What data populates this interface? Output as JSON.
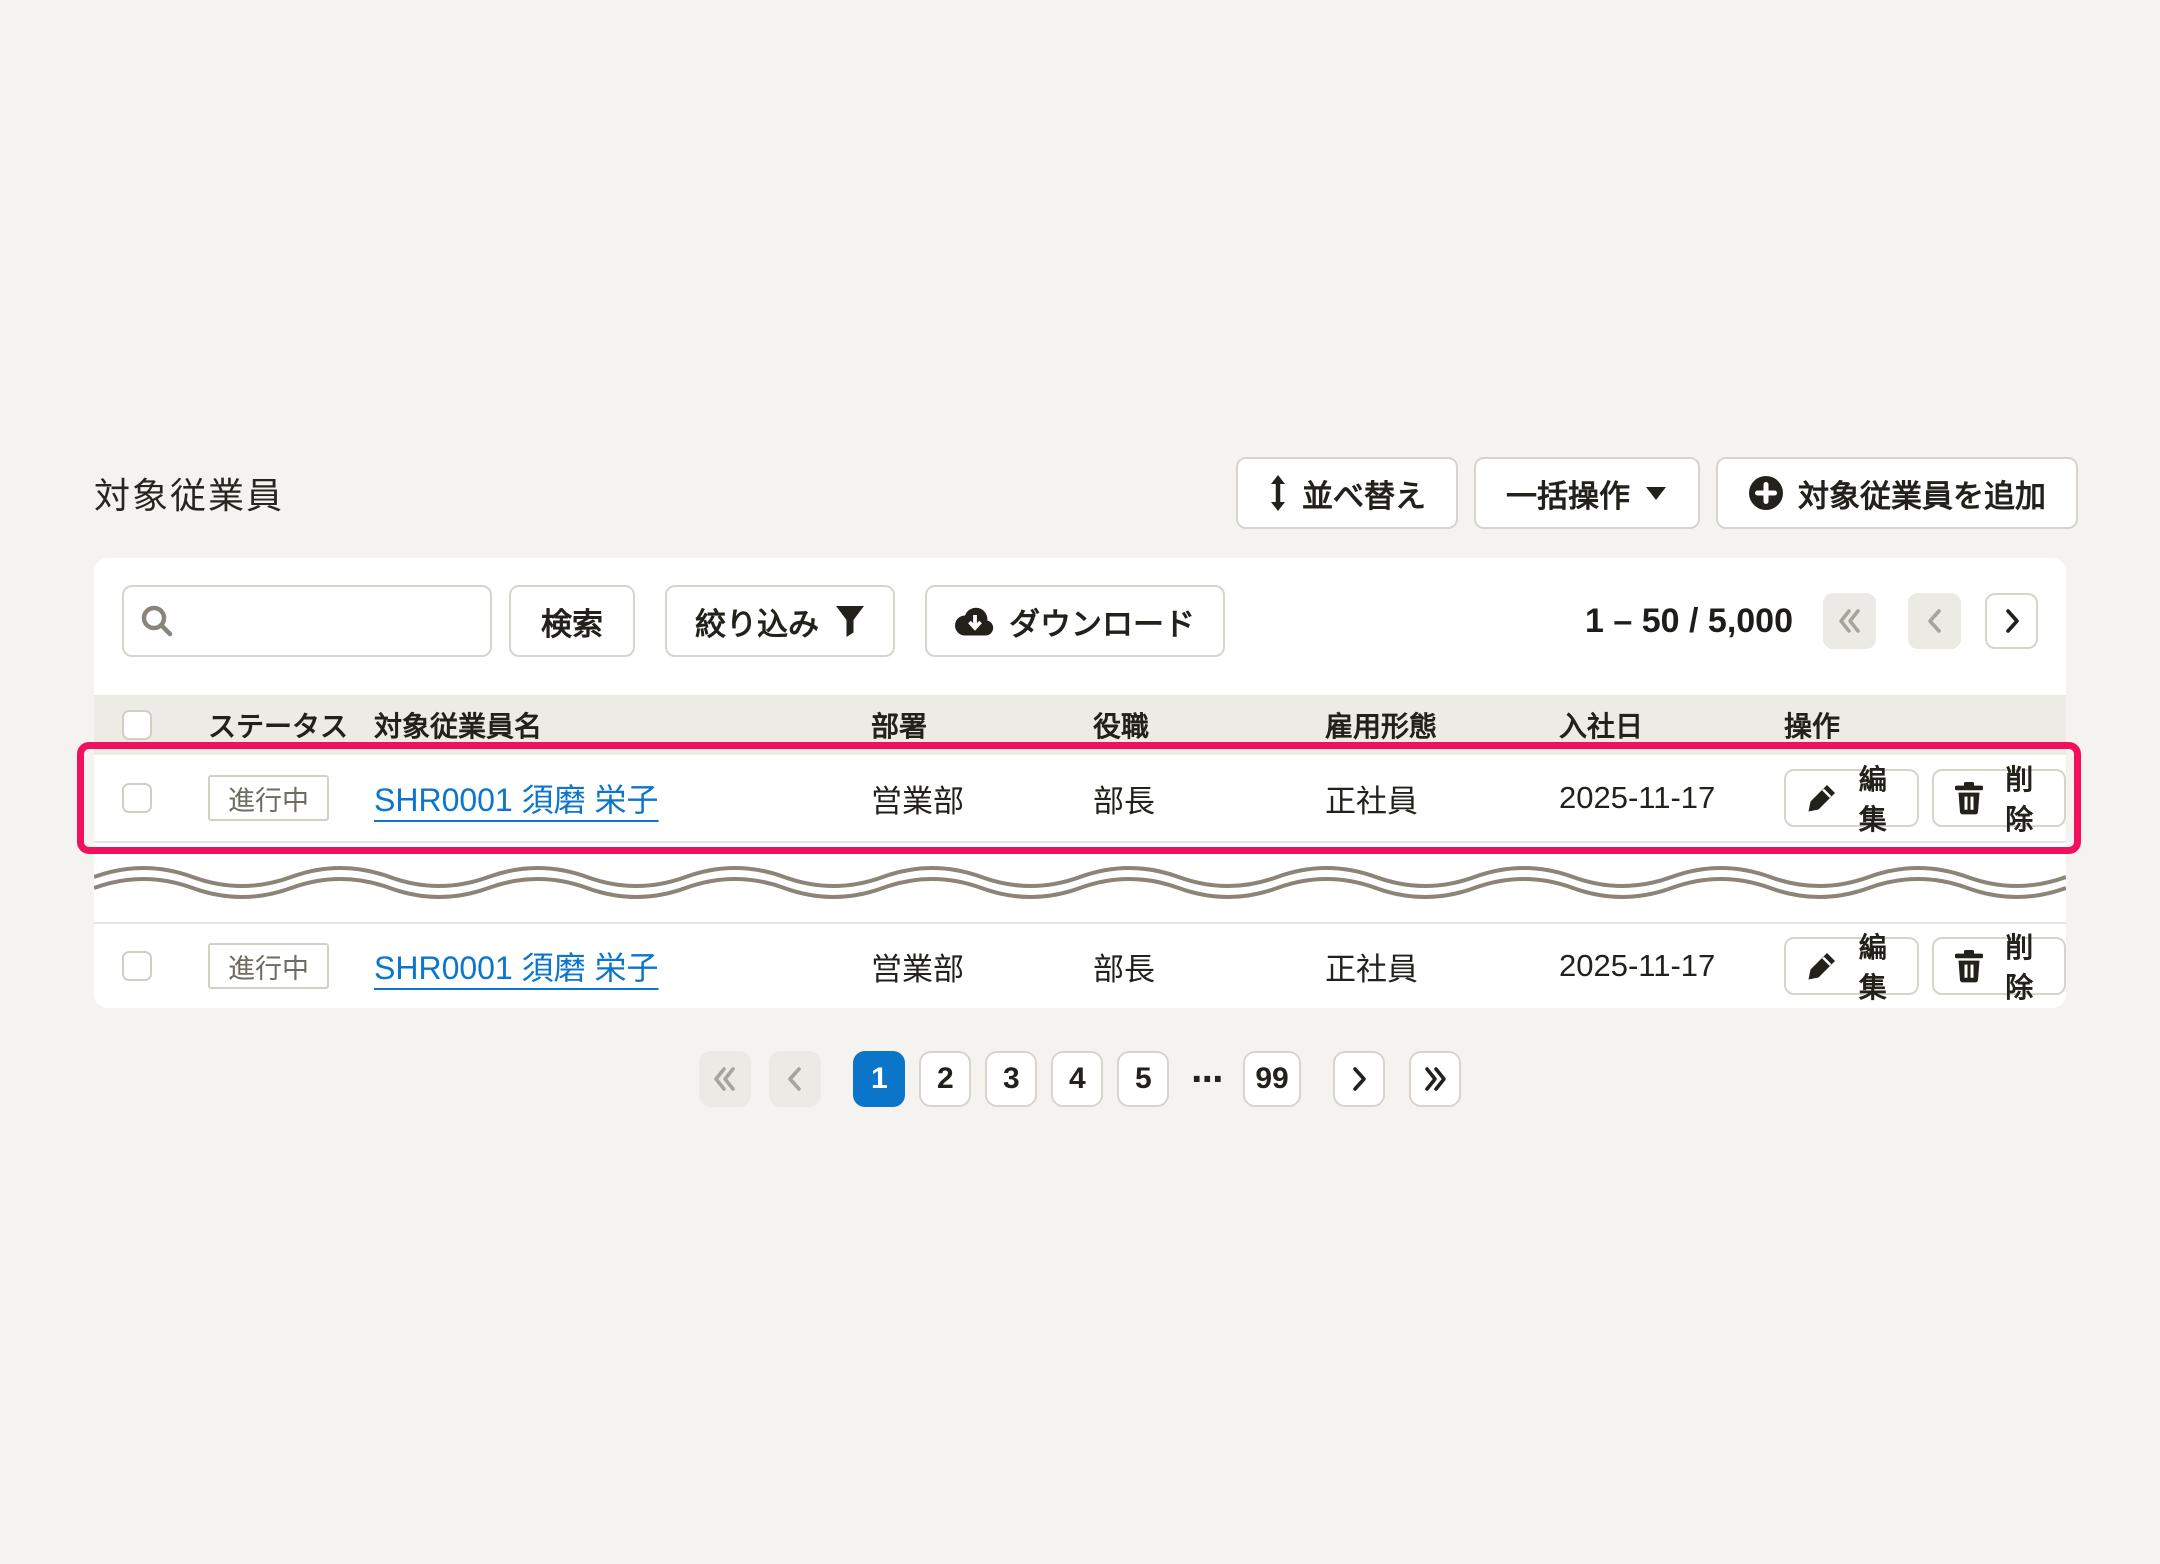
{
  "page": {
    "title": "対象従業員"
  },
  "toolbar": {
    "sort_label": "並べ替え",
    "bulk_label": "一括操作",
    "add_label": "対象従業員を追加"
  },
  "search": {
    "input_value": "",
    "search_label": "検索",
    "filter_label": "絞り込み",
    "download_label": "ダウンロード"
  },
  "pagination_top": {
    "range_text": "1 – 50 / 5,000"
  },
  "table": {
    "columns": {
      "status": "ステータス",
      "name": "対象従業員名",
      "department": "部署",
      "position": "役職",
      "employment": "雇用形態",
      "hire_date": "入社日",
      "actions": "操作"
    },
    "rows": [
      {
        "status": "進行中",
        "name": "SHR0001 須磨 栄子",
        "department": "営業部",
        "position": "部長",
        "employment": "正社員",
        "hire_date": "2025-11-17",
        "edit_label": "編集",
        "delete_label": "削除"
      },
      {
        "status": "進行中",
        "name": "SHR0001 須磨 栄子",
        "department": "営業部",
        "position": "部長",
        "employment": "正社員",
        "hire_date": "2025-11-17",
        "edit_label": "編集",
        "delete_label": "削除"
      }
    ]
  },
  "pagination_bottom": {
    "pages": [
      "1",
      "2",
      "3",
      "4",
      "5"
    ],
    "ellipsis": "⋯",
    "last_page": "99",
    "active_page": "1"
  },
  "icons": {
    "sort": "up-down-arrow",
    "bulk_caret": "chevron-down",
    "add": "plus-circle",
    "search": "magnifier",
    "filter": "funnel",
    "download": "cloud-download",
    "edit": "pencil",
    "delete": "trash",
    "first": "double-chevron-left",
    "prev": "chevron-left",
    "next": "chevron-right",
    "last": "double-chevron-right"
  },
  "colors": {
    "highlight_pink": "#f0115e",
    "link_blue": "#0b76cb",
    "active_page_blue": "#0b75c9",
    "page_background": "#f5f3ef",
    "table_header_bg": "#edebe6",
    "border_gray": "#d8d4cc",
    "muted_text": "#6f6b62"
  }
}
